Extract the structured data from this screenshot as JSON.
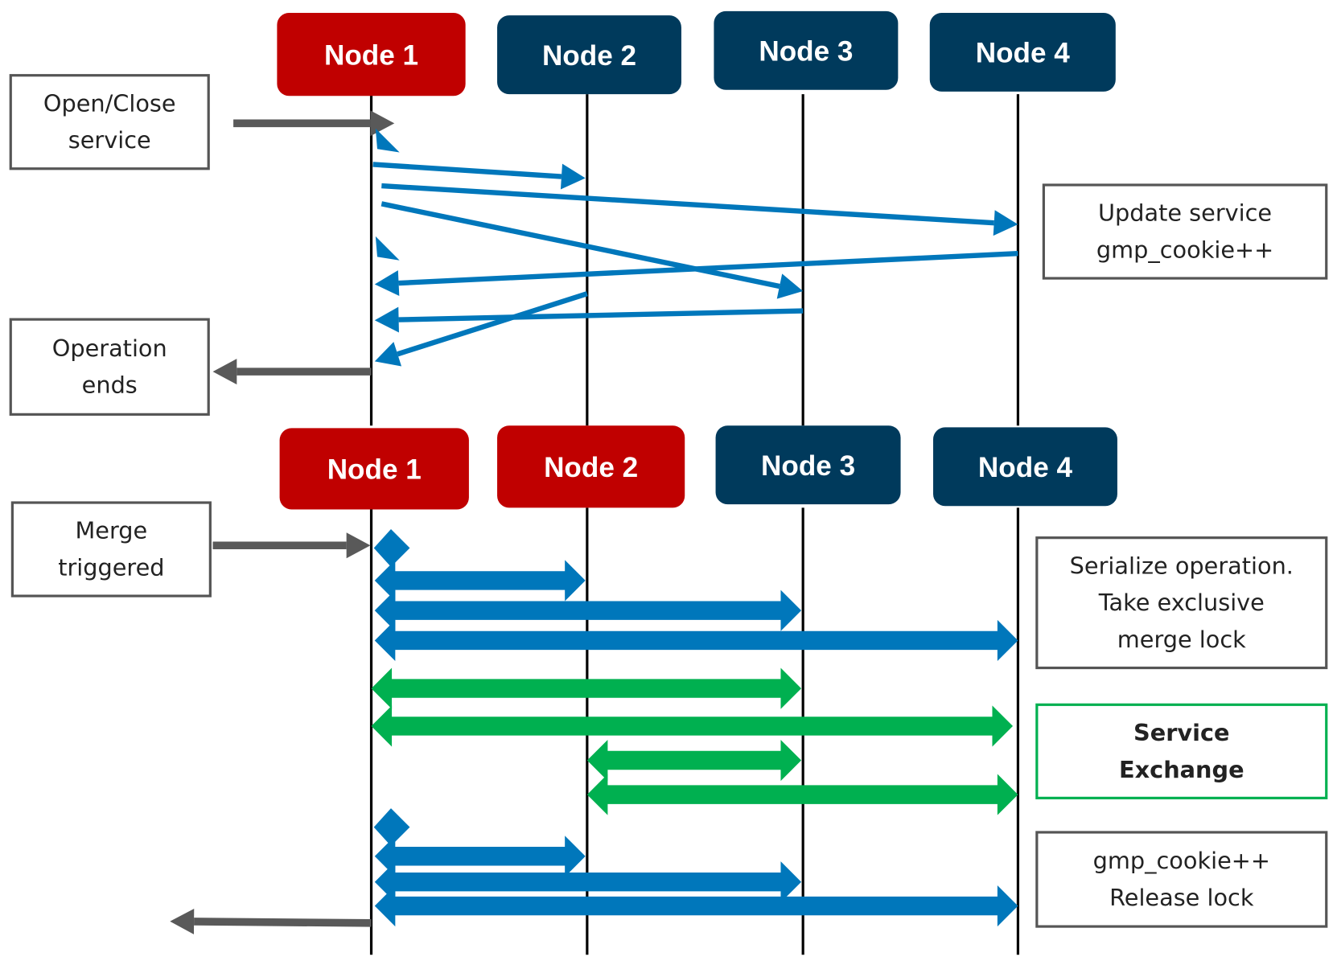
{
  "colors": {
    "active_node": "#c00000",
    "node": "#003a5c",
    "message": "#0077bb",
    "exchange": "#00b050",
    "external": "#595959"
  },
  "top": {
    "nodes": [
      "Node 1",
      "Node 2",
      "Node 3",
      "Node 4"
    ],
    "left_notes": [
      [
        "Open/Close",
        "service"
      ],
      [
        "Operation",
        "ends"
      ]
    ],
    "right_notes": [
      [
        "Update service",
        "gmp_cookie++"
      ]
    ]
  },
  "bottom": {
    "nodes": [
      "Node 1",
      "Node 2",
      "Node 3",
      "Node 4"
    ],
    "left_notes": [
      [
        "Merge",
        "triggered"
      ]
    ],
    "right_notes": [
      [
        "Serialize operation.",
        "Take exclusive",
        "merge lock"
      ],
      [
        "Service",
        "Exchange"
      ],
      [
        "gmp_cookie++",
        "Release lock"
      ]
    ]
  }
}
